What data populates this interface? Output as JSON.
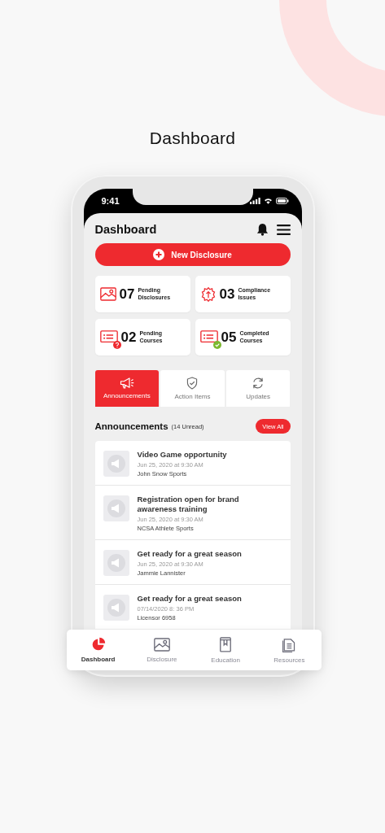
{
  "page_title": "Dashboard",
  "status_bar": {
    "time": "9:41"
  },
  "header": {
    "title": "Dashboard"
  },
  "primary_button": {
    "label": "New Disclosure"
  },
  "stats": [
    {
      "kind": "image",
      "count": "07",
      "label": "Pending Disclosures"
    },
    {
      "kind": "gear",
      "count": "03",
      "label": "Compliance Issues"
    },
    {
      "kind": "list",
      "count": "02",
      "label": "Pending Courses",
      "badge": {
        "kind": "question"
      }
    },
    {
      "kind": "list",
      "count": "05",
      "label": "Completed Courses",
      "badge": {
        "kind": "check"
      }
    }
  ],
  "tabs": [
    {
      "label": "Announcements",
      "kind": "megaphone",
      "selected": true
    },
    {
      "label": "Action Items",
      "kind": "shield",
      "selected": false
    },
    {
      "label": "Updates",
      "kind": "refresh",
      "selected": false
    }
  ],
  "announcements": {
    "title": "Announcements",
    "count": "(14 Unread)",
    "view_all": "View All",
    "items": [
      {
        "title": "Video Game opportunity",
        "date": "Jun 25, 2020 at 9:30 AM",
        "source": "John Snow Sports"
      },
      {
        "title": "Registration open for brand awareness training",
        "date": "Jun 25, 2020 at 9:30 AM",
        "source": "NCSA Athlete Sports"
      },
      {
        "title": "Get ready for a great season",
        "date": "Jun 25, 2020 at 9:30 AM",
        "source": "Jammie Lannister"
      },
      {
        "title": "Get ready for a great season",
        "date": "07/14/2020 8: 36 PM",
        "source": "Licensor 6958"
      }
    ]
  },
  "nav": [
    {
      "label": "Dashboard",
      "kind": "pie",
      "selected": true
    },
    {
      "label": "Disclosure",
      "kind": "image",
      "selected": false
    },
    {
      "label": "Education",
      "kind": "book",
      "selected": false
    },
    {
      "label": "Resources",
      "kind": "docs",
      "selected": false
    }
  ]
}
